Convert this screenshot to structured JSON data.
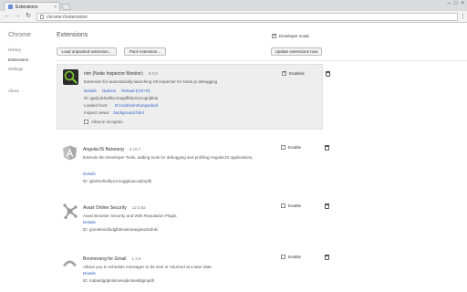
{
  "browser": {
    "tab_title": "Extensions",
    "tab_close": "×",
    "url": "chrome://extensions",
    "back": "←",
    "forward": "→",
    "reload": "↻",
    "menu": "⋮",
    "win_min": "–",
    "win_max": "□",
    "win_close": "×"
  },
  "sidebar": {
    "brand": "Chrome",
    "items": [
      {
        "label": "History"
      },
      {
        "label": "Extensions"
      },
      {
        "label": "Settings"
      },
      {
        "label": "About"
      }
    ]
  },
  "header": {
    "title": "Extensions",
    "developer_mode_label": "Developer mode",
    "developer_mode_checked": true,
    "buttons": {
      "load_unpacked": "Load unpacked extension...",
      "pack": "Pack extension...",
      "update": "Update extensions now"
    }
  },
  "extensions": [
    {
      "name": "nim (Node Inspector Monitor)",
      "version": "0.0.0",
      "description": "Extension for automatically launching V8 Inspector for Node.js debugging",
      "links": [
        "Details",
        "Options",
        "Reload (Ctrl+R)"
      ],
      "id_line": "ID: gpdjcddodkfycmagdfbhpmncognjbbai",
      "loaded_from_label": "Loaded from:",
      "loaded_from": "D:\\code\\nim2\\unpacked",
      "inspect_label": "Inspect views:",
      "inspect_link": "background.html",
      "incognito_label": "Allow in incognito",
      "enable_label": "Enabled",
      "enabled": true
    },
    {
      "name": "AngularJS Batarang",
      "version": "0.10.7",
      "description": "Extends the Developer Tools, adding tools for debugging and profiling AngularJS applications.",
      "links": [
        "Details"
      ],
      "id_line": "ID: ighdmehidhipcmcojjgiloacoafjmpfk",
      "enable_label": "Enable",
      "enabled": false
    },
    {
      "name": "Avast Online Security",
      "version": "12.0.82",
      "description": "Avast Browser Security and Web Reputation Plugin.",
      "links": [
        "Details"
      ],
      "id_line": "ID: gomekmidlodglbbmalcneegieacbdmki",
      "enable_label": "Enable",
      "enabled": false
    },
    {
      "name": "Boomerang for Gmail",
      "version": "1.2.6",
      "description": "Allows you to schedule messages to be sent or returned at a later date.",
      "links": [
        "Details"
      ],
      "id_line": "ID: mdanidgdpmkimeiiojknlnekblgmpdll",
      "enable_label": "Enable",
      "enabled": false
    }
  ],
  "colors": {
    "link": "#3463c5",
    "selected_card_bg": "#eeeeee"
  }
}
